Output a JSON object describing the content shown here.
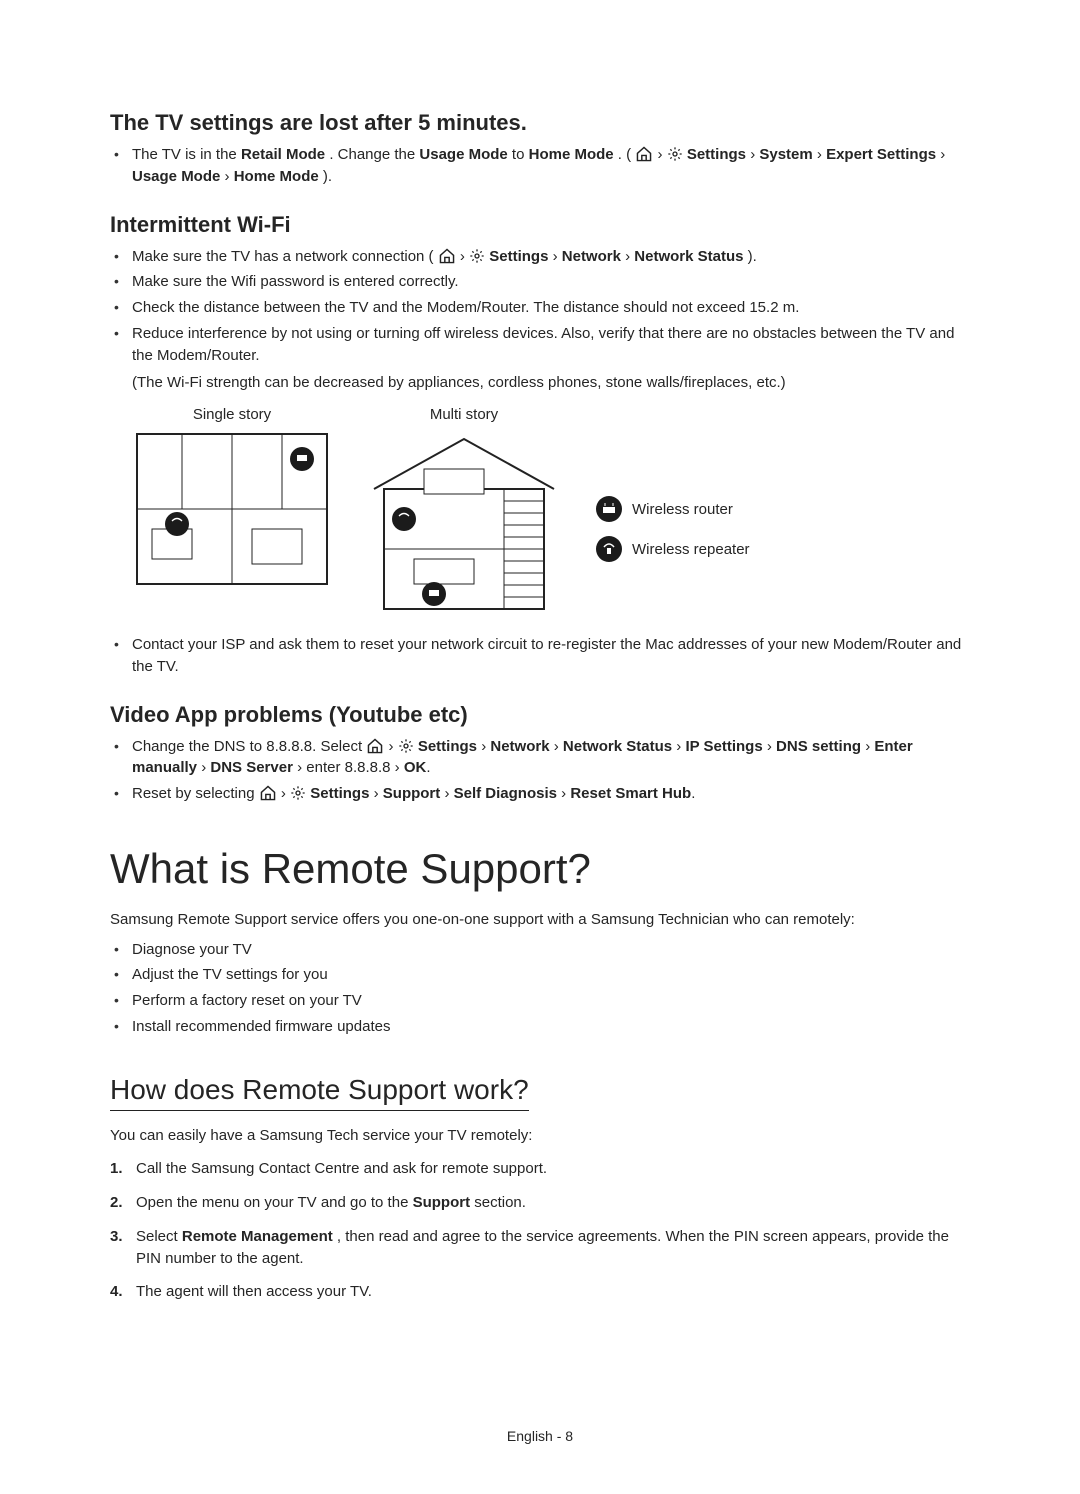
{
  "sections": {
    "tv_settings": {
      "heading": "The TV settings are lost after 5 minutes.",
      "bullet1_pre": "The TV is in the ",
      "bullet1_retail": "Retail Mode",
      "bullet1_mid": ". Change the ",
      "bullet1_usage": "Usage Mode",
      "bullet1_to": " to ",
      "bullet1_home": "Home Mode",
      "bullet1_open": ". (",
      "path": {
        "settings": "Settings",
        "system": "System",
        "expert": "Expert Settings",
        "usage": "Usage Mode",
        "home": "Home Mode"
      },
      "bullet1_close": ")."
    },
    "wifi": {
      "heading": "Intermittent Wi-Fi",
      "b1_pre": "Make sure the TV has a network connection (",
      "b1_path": {
        "settings": "Settings",
        "network": "Network",
        "status": "Network Status"
      },
      "b1_close": ").",
      "b2": "Make sure the Wifi password is entered correctly.",
      "b3": "Check the distance between the TV and the Modem/Router. The distance should not exceed 15.2 m.",
      "b4": "Reduce interference by not using or turning off wireless devices. Also, verify that there are no obstacles between the TV and the Modem/Router.",
      "b4_note": "(The Wi-Fi strength can be decreased by appliances, cordless phones, stone walls/fireplaces, etc.)",
      "diag_single": "Single story",
      "diag_multi": "Multi story",
      "legend_router": "Wireless router",
      "legend_repeater": "Wireless repeater",
      "b5": "Contact your ISP and ask them to reset your network circuit to re-register the Mac addresses of your new Modem/Router and the TV."
    },
    "video": {
      "heading": "Video App problems (Youtube etc)",
      "b1_pre": "Change the DNS to 8.8.8.8. Select ",
      "b1_path": {
        "settings": "Settings",
        "network": "Network",
        "status": "Network Status",
        "ip": "IP Settings",
        "dns_setting": "DNS setting",
        "enter": "Enter manually",
        "dns_server": "DNS Server"
      },
      "b1_tail": " enter 8.8.8.8 ",
      "b1_ok": "OK",
      "b2_pre": "Reset by selecting ",
      "b2_path": {
        "settings": "Settings",
        "support": "Support",
        "self": "Self Diagnosis",
        "reset": "Reset Smart Hub"
      }
    },
    "remote": {
      "title": "What is Remote Support?",
      "intro": "Samsung Remote Support service offers you one-on-one support with a Samsung Technician who can remotely:",
      "b1": "Diagnose your TV",
      "b2": "Adjust the TV settings for you",
      "b3": "Perform a factory reset on your TV",
      "b4": "Install recommended firmware updates"
    },
    "how": {
      "heading": "How does Remote Support work?",
      "intro": "You can easily have a Samsung Tech service your TV remotely:",
      "s1": "Call the Samsung Contact Centre and ask for remote support.",
      "s2_pre": "Open the menu on your TV and go to the ",
      "s2_support": "Support",
      "s2_post": " section.",
      "s3_pre": "Select ",
      "s3_rm": "Remote Management",
      "s3_post": ", then read and agree to the service agreements. When the PIN screen appears, provide the PIN number to the agent.",
      "s4": "The agent will then access your TV.",
      "n1": "1.",
      "n2": "2.",
      "n3": "3.",
      "n4": "4."
    }
  },
  "glyphs": {
    "arrow": " › "
  },
  "footer": "English - 8"
}
